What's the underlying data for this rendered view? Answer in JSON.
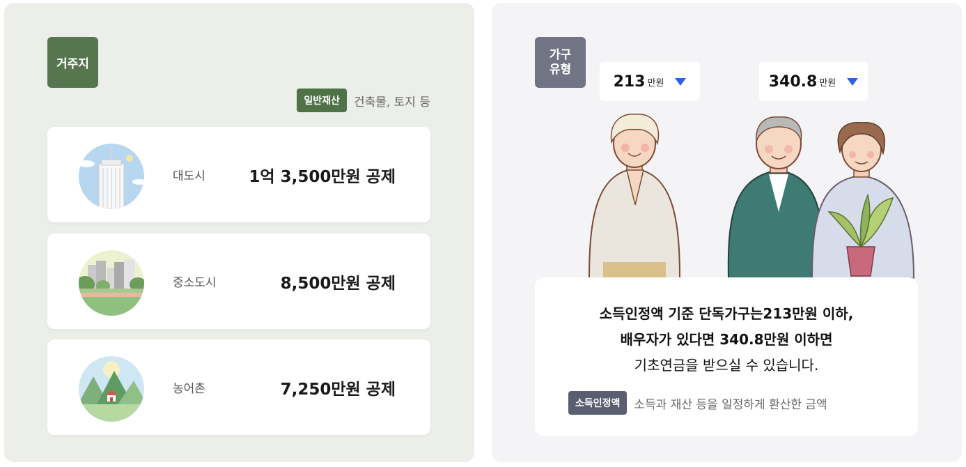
{
  "residence": {
    "tag": "거주지",
    "note_chip": "일반재산",
    "note_text": "건축물, 토지 등",
    "regions": [
      {
        "name": "대도시",
        "amount": "1억 3,500만원 공제",
        "illustration": "city-icon"
      },
      {
        "name": "중소도시",
        "amount": "8,500만원 공제",
        "illustration": "town-icon"
      },
      {
        "name": "농어촌",
        "amount": "7,250만원 공제",
        "illustration": "village-icon"
      }
    ]
  },
  "household": {
    "tag": "가구\n유형",
    "single": {
      "value": "213",
      "unit": "만원"
    },
    "couple": {
      "value": "340.8",
      "unit": "만원"
    },
    "description": {
      "line1": "소득인정액 기준 단독가구는213만원 이하,",
      "line2": "배우자가 있다면 340.8만원 이하면",
      "line3": "기초연금을 받으실 수 있습니다."
    },
    "note_chip": "소득인정액",
    "note_text": "소득과 재산 등을 일정하게 환산한 금액"
  },
  "colors": {
    "residence_tag": "#567650",
    "household_tag": "#727486",
    "dropdown_arrow": "#2b62e8"
  }
}
